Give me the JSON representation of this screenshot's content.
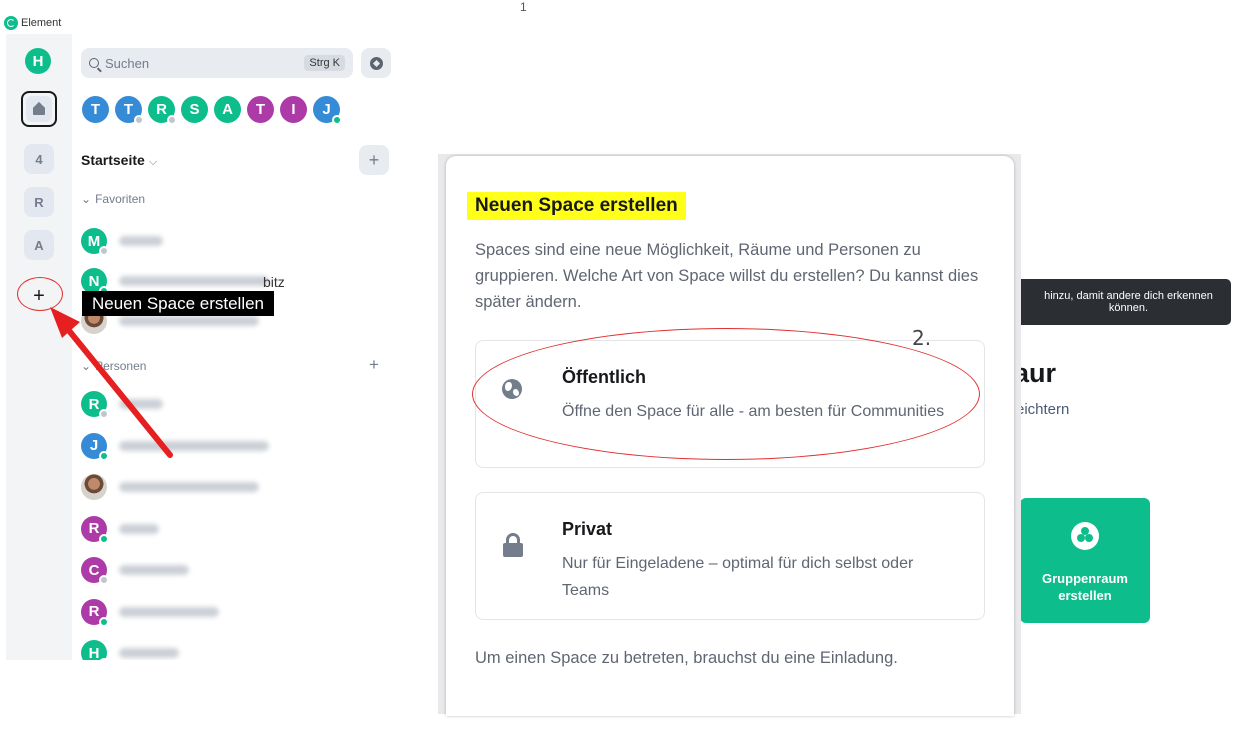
{
  "window": {
    "title": "Element",
    "top_marker": "1"
  },
  "spaces": {
    "user_initial": "H",
    "items": [
      {
        "label": "4"
      },
      {
        "label": "R"
      },
      {
        "label": "A"
      }
    ],
    "create_label": "+"
  },
  "search": {
    "placeholder": "Suchen",
    "shortcut": "Strg K"
  },
  "recent": [
    {
      "initial": "T",
      "color": "#368bd6",
      "badge": "none"
    },
    {
      "initial": "T",
      "color": "#368bd6",
      "badge": "offline"
    },
    {
      "initial": "R",
      "color": "#0dbd8b",
      "badge": "offline"
    },
    {
      "initial": "S",
      "color": "#0dbd8b",
      "badge": "none"
    },
    {
      "initial": "A",
      "color": "#0dbd8b",
      "badge": "none"
    },
    {
      "initial": "T",
      "color": "#ac3ba8",
      "badge": "none"
    },
    {
      "initial": "I",
      "color": "#ac3ba8",
      "badge": "none"
    },
    {
      "initial": "J",
      "color": "#368bd6",
      "badge": "online"
    }
  ],
  "roomlist": {
    "home_title": "Startseite",
    "favorites_label": "Favoriten",
    "favorites": [
      {
        "initial": "M",
        "color": "#0dbd8b"
      },
      {
        "initial": "N",
        "color": "#0dbd8b",
        "visible_suffix": "bitz"
      },
      {
        "initial": "",
        "color": "photo"
      }
    ],
    "people_label": "Personen",
    "people": [
      {
        "initial": "R",
        "color": "#0dbd8b"
      },
      {
        "initial": "J",
        "color": "#368bd6"
      },
      {
        "initial": "",
        "color": "photo"
      },
      {
        "initial": "R",
        "color": "#ac3ba8"
      },
      {
        "initial": "C",
        "color": "#ac3ba8"
      },
      {
        "initial": "R",
        "color": "#ac3ba8"
      },
      {
        "initial": "H",
        "color": "#0dbd8b"
      }
    ]
  },
  "tooltip": {
    "text": "Neuen Space erstellen"
  },
  "background": {
    "notice": "hinzu, damit andere dich erkennen können.",
    "heading_fragment": "aur",
    "sub_fragment": "eichtern",
    "card_label": "Gruppenraum erstellen"
  },
  "dialog": {
    "title": "Neuen Space erstellen",
    "description": "Spaces sind eine neue Möglichkeit, Räume und Personen zu gruppieren. Welche Art von Space willst du erstellen? Du kannst dies später ändern.",
    "annotation": "2.",
    "options": [
      {
        "title": "Öffentlich",
        "description": "Öffne den Space für alle - am besten für Communities"
      },
      {
        "title": "Privat",
        "description": "Nur für Eingeladene – optimal für dich selbst oder Teams"
      }
    ],
    "footer": "Um einen Space zu betreten, brauchst du eine Einladung."
  }
}
